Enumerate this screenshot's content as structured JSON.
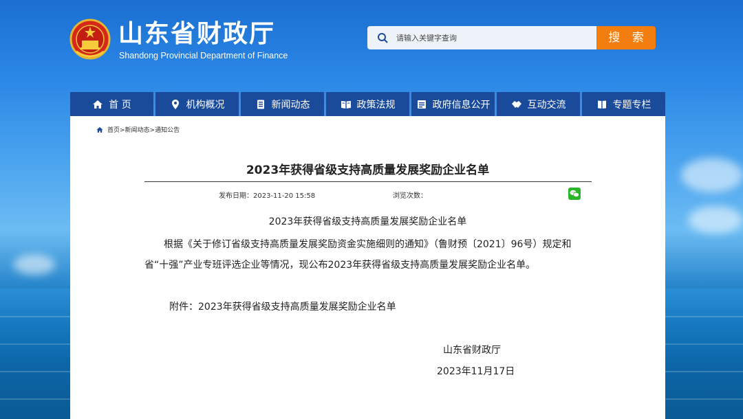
{
  "header": {
    "title_cn": "山东省财政厅",
    "title_en": "Shandong Provincial Department of Finance",
    "emblem_icon": "national-emblem-icon"
  },
  "search": {
    "placeholder": "请输入关键字查询",
    "button_label": "搜 索"
  },
  "nav": {
    "items": [
      {
        "label": "首 页",
        "icon": "home-icon"
      },
      {
        "label": "机构概况",
        "icon": "location-pin-icon"
      },
      {
        "label": "新闻动态",
        "icon": "newspaper-icon"
      },
      {
        "label": "政策法规",
        "icon": "open-book-icon"
      },
      {
        "label": "政府信息公开",
        "icon": "document-list-icon"
      },
      {
        "label": "互动交流",
        "icon": "handshake-icon"
      },
      {
        "label": "专题专栏",
        "icon": "book-icon"
      }
    ]
  },
  "breadcrumb": {
    "items": [
      "首页>",
      " 新闻动态>",
      " 通知公告"
    ]
  },
  "article": {
    "title": "2023年获得省级支持高质量发展奖励企业名单",
    "publish_date_label": "发布日期：2023-11-20 15:58",
    "views_label": "浏览次数：",
    "subtitle": "2023年获得省级支持高质量发展奖励企业名单",
    "paragraph": "根据《关于修订省级支持高质量发展奖励资金实施细则的通知》（鲁财预〔2021〕96号）规定和省“十强”产业专班评选企业等情况，现公布2023年获得省级支持高质量发展奖励企业名单。",
    "attachment": "附件：2023年获得省级支持高质量发展奖励企业名单",
    "signature_org": "山东省财政厅",
    "signature_date": "2023年11月17日"
  },
  "colors": {
    "nav_bg": "#1a4a9a",
    "search_button": "#f47d0f",
    "wechat_green": "#2bb52b"
  }
}
